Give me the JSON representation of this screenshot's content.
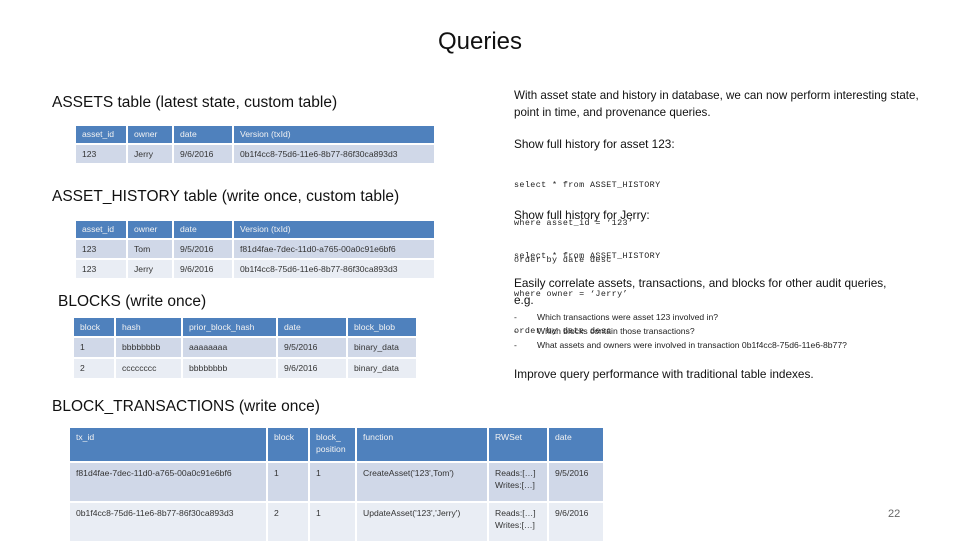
{
  "slide": {
    "title": "Queries",
    "page_number": "22"
  },
  "assets": {
    "title": "ASSETS table (latest state, custom table)",
    "headers": [
      "asset_id",
      "owner",
      "date",
      "Version (txId)"
    ],
    "rows": [
      [
        "123",
        "Jerry",
        "9/6/2016",
        "0b1f4cc8-75d6-11e6-8b77-86f30ca893d3"
      ]
    ]
  },
  "asset_history": {
    "title": "ASSET_HISTORY table (write once, custom table)",
    "headers": [
      "asset_id",
      "owner",
      "date",
      "Version (txId)"
    ],
    "rows": [
      [
        "123",
        "Tom",
        "9/5/2016",
        "f81d4fae-7dec-11d0-a765-00a0c91e6bf6"
      ],
      [
        "123",
        "Jerry",
        "9/6/2016",
        "0b1f4cc8-75d6-11e6-8b77-86f30ca893d3"
      ]
    ]
  },
  "blocks": {
    "title": "BLOCKS (write once)",
    "headers": [
      "block",
      "hash",
      "prior_block_hash",
      "date",
      "block_blob"
    ],
    "rows": [
      [
        "1",
        "bbbbbbbb",
        "aaaaaaaa",
        "9/5/2016",
        "binary_data"
      ],
      [
        "2",
        "cccccccc",
        "bbbbbbbb",
        "9/6/2016",
        "binary_data"
      ]
    ]
  },
  "block_transactions": {
    "title": "BLOCK_TRANSACTIONS (write once)",
    "headers": [
      "tx_id",
      "block",
      "block_\nposition",
      "function",
      "RWSet",
      "date"
    ],
    "rows": [
      [
        "f81d4fae-7dec-11d0-a765-00a0c91e6bf6",
        "1",
        "1",
        "CreateAsset('123',Tom')",
        "Reads:[…]\nWrites:[…]",
        "9/5/2016"
      ],
      [
        "0b1f4cc8-75d6-11e6-8b77-86f30ca893d3",
        "2",
        "1",
        "UpdateAsset('123','Jerry')",
        "Reads:[…]\nWrites:[…]",
        "9/6/2016"
      ]
    ]
  },
  "right_panel": {
    "intro": "With asset state and history in database, we can now perform interesting state, point in time, and provenance queries.",
    "query1": {
      "heading": "Show full history for asset 123:",
      "code": [
        "select * from ASSET_HISTORY",
        "where asset_id = ‘123’",
        "order by date desc"
      ]
    },
    "query2": {
      "heading": "Show full history for Jerry:",
      "code": [
        "select * from ASSET_HISTORY",
        "where owner = ‘Jerry’",
        "order by date desc"
      ]
    },
    "correlate": {
      "heading": "Easily correlate assets, transactions, and blocks for other audit queries, e.g.",
      "bullets": [
        "Which transactions were asset 123 involved in?",
        "Which blocks contain those transactions?",
        "What assets and owners were involved in transaction 0b1f4cc8-75d6-11e6-8b77?"
      ]
    },
    "performance": "Improve query performance with traditional table indexes."
  }
}
